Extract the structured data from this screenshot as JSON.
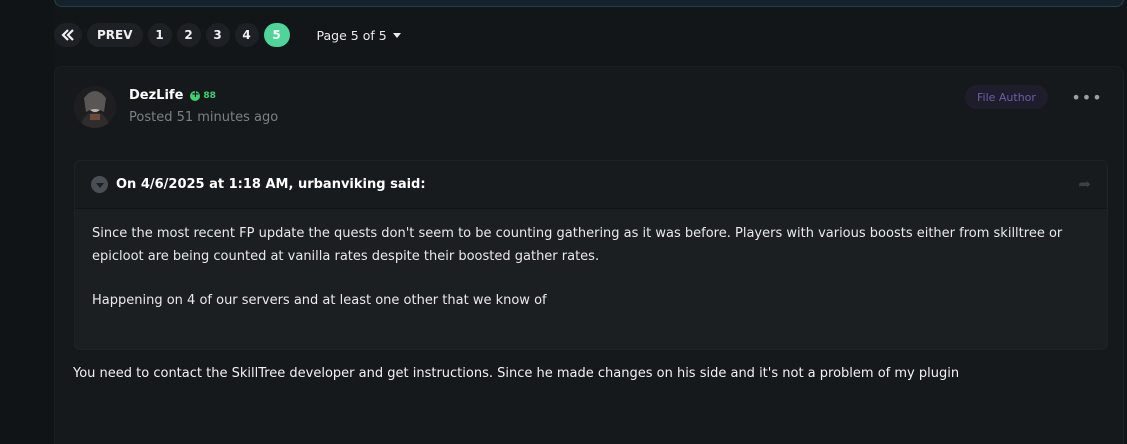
{
  "pagination": {
    "first_icon": "double-chevron-left-icon",
    "prev_label": "PREV",
    "pages": [
      "1",
      "2",
      "3",
      "4",
      "5"
    ],
    "active_page": "5",
    "page_of_label": "Page 5 of 5"
  },
  "post": {
    "author": "DezLife",
    "reputation": "88",
    "posted": "Posted 51 minutes ago",
    "badge": "File Author",
    "menu_icon": "more-horizontal-icon",
    "quote": {
      "header": "On 4/6/2025 at 1:18 AM, urbanviking said:",
      "paragraphs": [
        "Since the most recent FP update the quests don't seem to be counting gathering as it was before. Players with various boosts either from skilltree or epicloot are being counted at vanilla rates despite their boosted gather rates.",
        "Happening on 4 of our servers and at least one other that we know of"
      ]
    },
    "reply": "You need to contact the SkillTree developer and get instructions. Since he made changes on his side and it's not a problem of my plugin"
  },
  "colors": {
    "accent": "#4fd49a",
    "reputation": "#3fd16a",
    "badge_text": "#6b5fa8"
  }
}
